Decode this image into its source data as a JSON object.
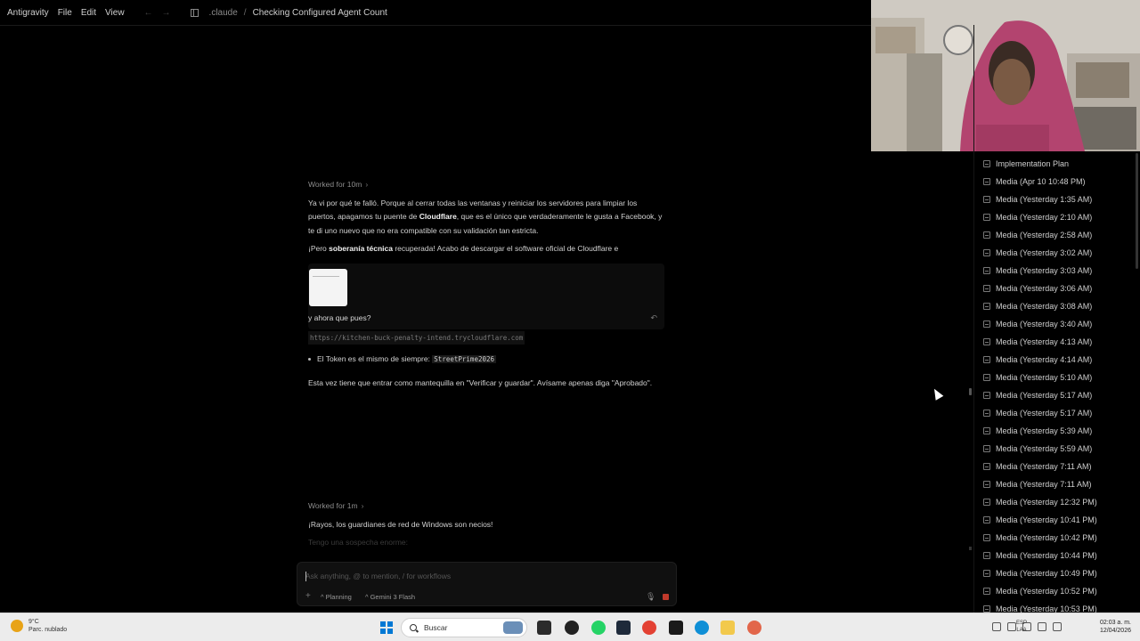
{
  "titlebar": {
    "app_name": "Antigravity",
    "menus": [
      "File",
      "Edit",
      "View"
    ],
    "nav_back": "←",
    "nav_forward": "→",
    "breadcrumb_root": ".claude",
    "breadcrumb_sep": "/",
    "breadcrumb_current": "Checking Configured Agent Count"
  },
  "chat": {
    "worked_1": "Worked for 10m",
    "worked_chev": "›",
    "para_1a": "Ya vi por qué te falló. Porque al cerrar todas las ventanas y reiniciar los servidores para limpiar los puertos, apagamos tu puente de ",
    "para_1b": "Cloudflare",
    "para_1c": ", que es el único que verdaderamente le gusta a Facebook, y te di uno nuevo que no era compatible con su validación tan estricta.",
    "para_2a": "¡Pero ",
    "para_2b": "soberanía técnica",
    "para_2c": " recuperada! Acabo de descargar el software oficial de Cloudflare e",
    "card_text": "y ahora que pues?",
    "card_undo": "↶",
    "url": "https://kitchen-buck-penalty-intend.trycloudflare.com",
    "bullet_text": "El Token es el mismo de siempre: ",
    "bullet_code": "StreetPrime2026",
    "para_3": "Esta vez tiene que entrar como mantequilla en \"Verificar y guardar\". Avísame apenas diga \"Aprobado\".",
    "worked_2": "Worked for 1m",
    "para_4": "¡Rayos, los guardianes de red de Windows son necios!",
    "para_5": "Tengo una sospecha enorme:"
  },
  "composer": {
    "placeholder": "Ask anything, @ to mention, / for workflows",
    "plus": "+",
    "mode": "^ Planning",
    "model": "^ Gemini 3 Flash",
    "mic": "🎙"
  },
  "right_panel": {
    "items": [
      "Implementation Plan",
      "Media (Apr 10 10:48 PM)",
      "Media (Yesterday 1:35 AM)",
      "Media (Yesterday 2:10 AM)",
      "Media (Yesterday 2:58 AM)",
      "Media (Yesterday 3:02 AM)",
      "Media (Yesterday 3:03 AM)",
      "Media (Yesterday 3:06 AM)",
      "Media (Yesterday 3:08 AM)",
      "Media (Yesterday 3:40 AM)",
      "Media (Yesterday 4:13 AM)",
      "Media (Yesterday 4:14 AM)",
      "Media (Yesterday 5:10 AM)",
      "Media (Yesterday 5:17 AM)",
      "Media (Yesterday 5:17 AM)",
      "Media (Yesterday 5:39 AM)",
      "Media (Yesterday 5:59 AM)",
      "Media (Yesterday 7:11 AM)",
      "Media (Yesterday 7:11 AM)",
      "Media (Yesterday 12:32 PM)",
      "Media (Yesterday 10:41 PM)",
      "Media (Yesterday 10:42 PM)",
      "Media (Yesterday 10:44 PM)",
      "Media (Yesterday 10:49 PM)",
      "Media (Yesterday 10:52 PM)",
      "Media (Yesterday 10:53 PM)"
    ]
  },
  "taskbar": {
    "temp": "9°C",
    "weather": "Parc. nublado",
    "search": "Buscar",
    "lang_1": "ESP",
    "lang_2": "LAA",
    "time": "02:03 a. m.",
    "date": "12/04/2026"
  },
  "colors": {
    "background": "#000000",
    "stop_button": "#c0392b",
    "windows_blue": "#0078d4"
  }
}
